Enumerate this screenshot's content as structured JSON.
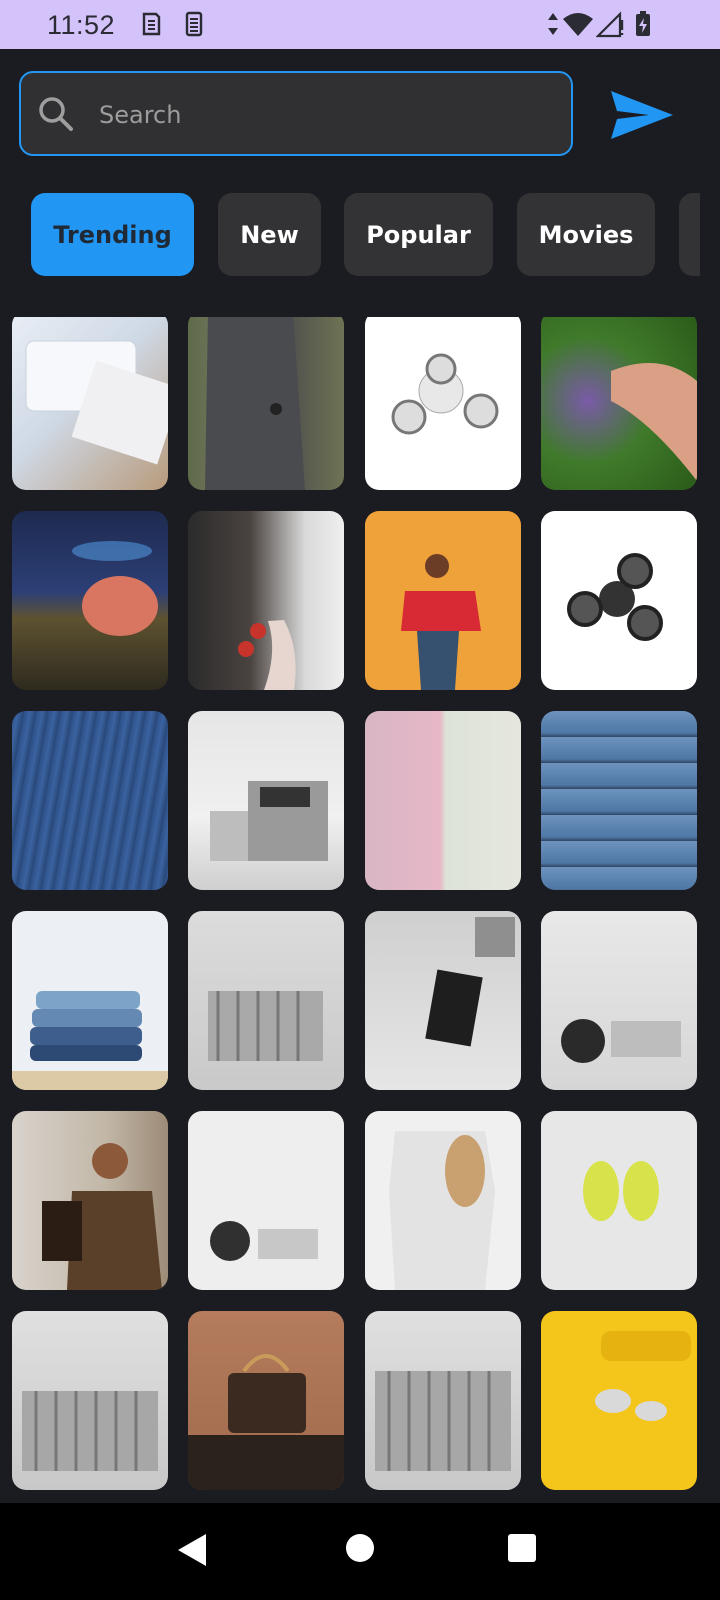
{
  "status_bar": {
    "time": "11:52",
    "icons": [
      "sim-icon",
      "battery-saver-icon",
      "data-arrows-icon",
      "wifi-icon",
      "cell-signal-icon",
      "battery-charging-icon"
    ]
  },
  "search": {
    "placeholder": "Search",
    "value": "",
    "accent_color": "#2196f3"
  },
  "categories": [
    {
      "label": "Trending",
      "active": true
    },
    {
      "label": "New",
      "active": false
    },
    {
      "label": "Popular",
      "active": false
    },
    {
      "label": "Movies",
      "active": false
    }
  ],
  "grid": {
    "items": [
      {
        "subject": "laptop-keyboard-photo"
      },
      {
        "subject": "man-in-suit-photo"
      },
      {
        "subject": "white-fidget-spinner-photo"
      },
      {
        "subject": "hand-spinning-fidget-photo"
      },
      {
        "subject": "spinner-on-finger-photo"
      },
      {
        "subject": "hair-and-red-spinner-photo"
      },
      {
        "subject": "woman-red-sweater-photo"
      },
      {
        "subject": "black-fidget-spinner-photo"
      },
      {
        "subject": "denim-texture-photo"
      },
      {
        "subject": "magazine-stack-photo"
      },
      {
        "subject": "pink-suits-photo"
      },
      {
        "subject": "folded-jeans-photo"
      },
      {
        "subject": "jeans-stack-photo"
      },
      {
        "subject": "magazine-rack-photo"
      },
      {
        "subject": "mirror-and-magazine-photo"
      },
      {
        "subject": "round-mirror-decor-photo"
      },
      {
        "subject": "man-with-backpack-photo"
      },
      {
        "subject": "white-decor-photo"
      },
      {
        "subject": "mannequin-photo"
      },
      {
        "subject": "yellow-slides-photo"
      },
      {
        "subject": "magazine-rack-photo-2"
      },
      {
        "subject": "leather-handbag-photo"
      },
      {
        "subject": "magazine-rack-photo-3"
      },
      {
        "subject": "yellow-accessories-photo"
      }
    ]
  },
  "nav_bar": {
    "buttons": [
      "back",
      "home",
      "recents"
    ]
  }
}
